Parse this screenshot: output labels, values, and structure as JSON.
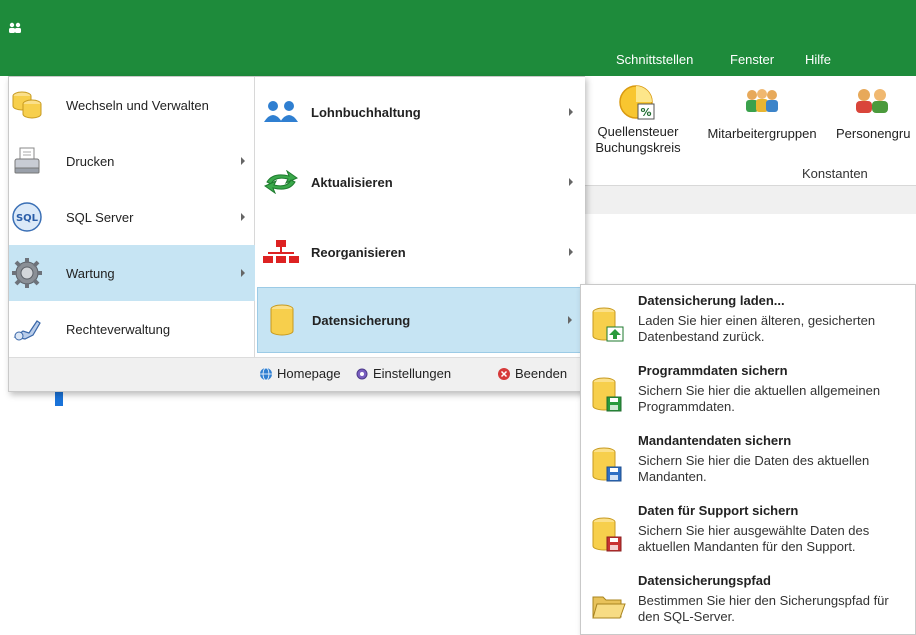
{
  "menubar": {
    "tabs": [
      "Schnittstellen",
      "Fenster",
      "Hilfe"
    ]
  },
  "ribbon": {
    "buttons": [
      {
        "label": "Quellensteuer\nBuchungskreis",
        "icon": "percent-coin-icon"
      },
      {
        "label": "Mitarbeitergruppen",
        "icon": "people-group-icon"
      },
      {
        "label": "Personengru",
        "icon": "persons-group-icon"
      }
    ],
    "group_label": "Konstanten"
  },
  "app_menu": {
    "left_items": [
      {
        "label": "Wechseln und Verwalten",
        "icon": "database-stack-icon",
        "has_submenu": false
      },
      {
        "label": "Drucken",
        "icon": "printer-icon",
        "has_submenu": true
      },
      {
        "label": "SQL Server",
        "icon": "sql-icon",
        "has_submenu": true
      },
      {
        "label": "Wartung",
        "icon": "gear-icon",
        "has_submenu": true,
        "active": true
      },
      {
        "label": "Rechteverwaltung",
        "icon": "key-icon",
        "has_submenu": false
      }
    ],
    "right_items": [
      {
        "label": "Lohnbuchhaltung",
        "icon": "users-icon"
      },
      {
        "label": "Aktualisieren",
        "icon": "refresh-arrows-icon"
      },
      {
        "label": "Reorganisieren",
        "icon": "org-chart-icon"
      },
      {
        "label": "Datensicherung",
        "icon": "database-icon",
        "active": true
      }
    ],
    "footer": {
      "homepage": "Homepage",
      "settings": "Einstellungen",
      "exit": "Beenden"
    }
  },
  "submenu": {
    "items": [
      {
        "title": "Datensicherung laden...",
        "desc": "Laden Sie hier einen älteren, gesicherten Datenbestand zurück.",
        "icon": "database-upload-icon"
      },
      {
        "title": "Programmdaten sichern",
        "desc": "Sichern Sie hier die aktuellen allgemeinen Programmdaten.",
        "icon": "database-save-green-icon"
      },
      {
        "title": "Mandantendaten sichern",
        "desc": "Sichern Sie hier die Daten des aktuellen Mandanten.",
        "icon": "database-save-blue-icon"
      },
      {
        "title": "Daten für Support sichern",
        "desc": "Sichern Sie hier ausgewählte Daten des aktuellen Mandanten für den Support.",
        "icon": "database-save-red-icon"
      },
      {
        "title": "Datensicherungspfad",
        "desc": "Bestimmen Sie hier den Sicherungspfad für den SQL-Server.",
        "icon": "folder-open-icon"
      }
    ]
  },
  "colors": {
    "titlebar": "#1e8b3b",
    "highlight": "#c6e4f3"
  }
}
